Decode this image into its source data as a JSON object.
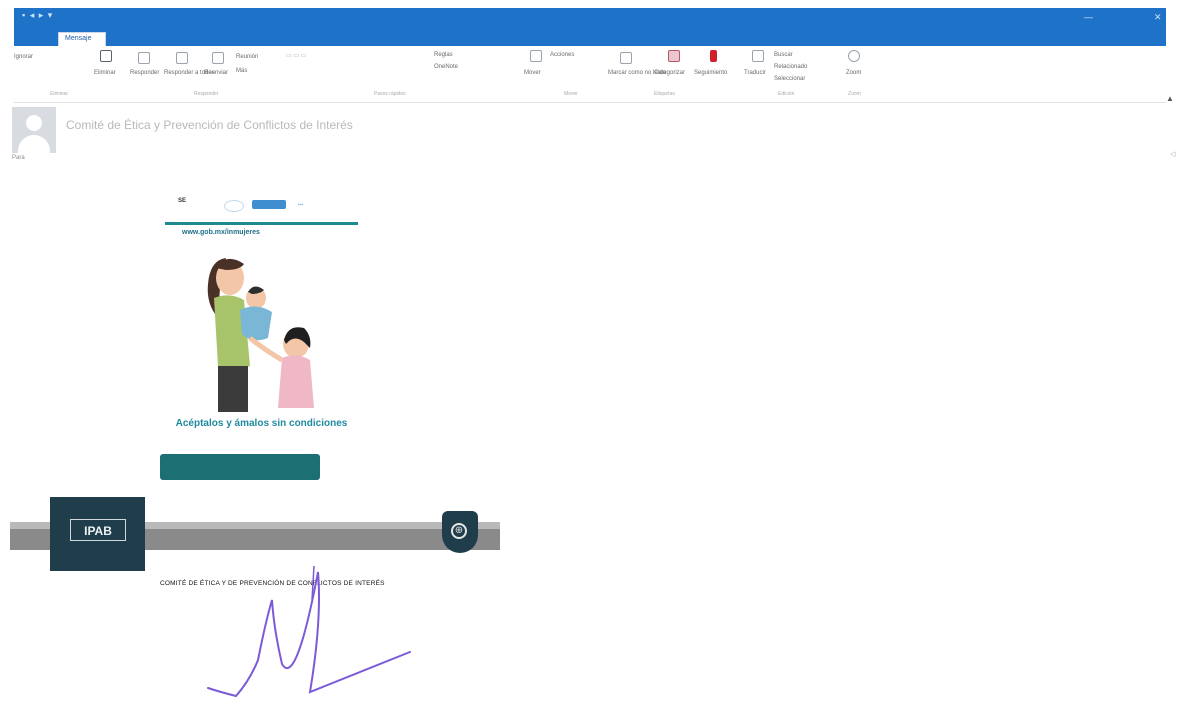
{
  "window": {
    "title": "",
    "active_tab": "Mensaje"
  },
  "ribbon": {
    "groups": [
      "Eliminar",
      "Responder",
      "Pasos rápidos",
      "Mover",
      "Etiquetas",
      "Edición",
      "Zoom"
    ],
    "buttons": {
      "ignore": "Ignorar",
      "delete": "Eliminar",
      "reply": "Responder",
      "reply_all": "Responder a todos",
      "forward": "Reenviar",
      "meeting": "Reunión",
      "more": "Más",
      "move": "Mover",
      "rules": "Reglas",
      "onenote": "OneNote",
      "actions": "Acciones",
      "mark_unread": "Marcar como no leído",
      "categorize": "Categorizar",
      "followup": "Seguimiento",
      "translate": "Traducir",
      "find": "Buscar",
      "related": "Relacionado",
      "select": "Seleccionar",
      "zoom": "Zoom"
    }
  },
  "message": {
    "sender": "Comité de Ética y Prevención de Conflictos de Interés",
    "recipients_label": "Para",
    "scroll_up": "▲",
    "scroll_side": "◁"
  },
  "banner": {
    "top_label": "SE",
    "url": "www.gob.mx/inmujeres",
    "headline": "Acéptalos y ámalos sin condiciones"
  },
  "signature": {
    "logo_text": "IPAB",
    "caption": "COMITÉ DE ÉTICA Y DE PREVENCIÓN DE CONFLICTOS DE INTERÉS"
  },
  "colors": {
    "title_bar": "#1e73c8",
    "banner_teal": "#1c6f73",
    "signature_navy": "#1f3d4a",
    "signature_ink": "#7b5bd6"
  },
  "icons": [
    "delete-icon",
    "reply-icon",
    "reply-all-icon",
    "forward-icon",
    "move-icon",
    "rules-icon",
    "flag-icon",
    "search-icon",
    "zoom-icon",
    "globe-icon",
    "avatar-icon"
  ]
}
